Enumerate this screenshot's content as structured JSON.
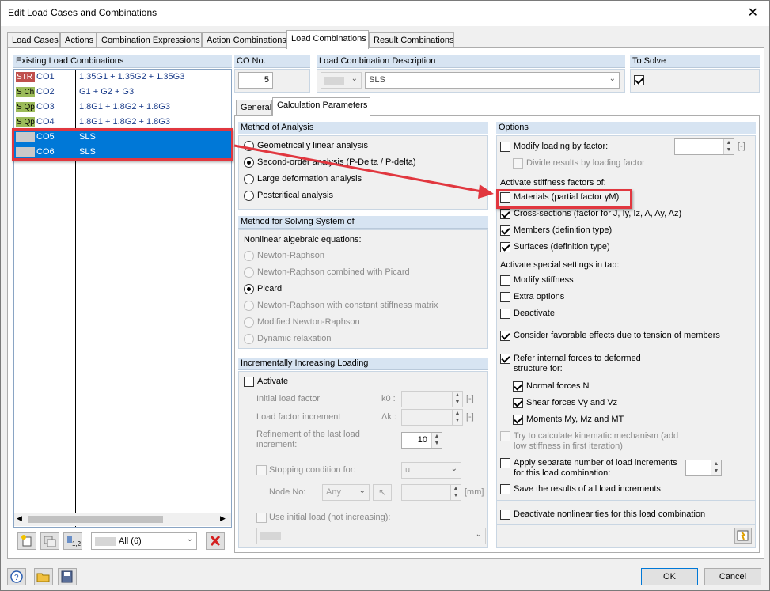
{
  "window": {
    "title": "Edit Load Cases and Combinations",
    "close": "✕"
  },
  "tabs": [
    "Load Cases",
    "Actions",
    "Combination Expressions",
    "Action Combinations",
    "Load Combinations",
    "Result Combinations"
  ],
  "existing": {
    "header": "Existing Load Combinations",
    "rows": [
      {
        "badge": "STR",
        "badge_color": "#c0504d",
        "badge_text_color": "#ffffff",
        "code": "CO1",
        "expr": "1.35G1 + 1.35G2 + 1.35G3"
      },
      {
        "badge": "S Ch",
        "badge_color": "#9bbb59",
        "badge_text_color": "#000000",
        "code": "CO2",
        "expr": "G1 + G2 + G3"
      },
      {
        "badge": "S Qp",
        "badge_color": "#9bbb59",
        "badge_text_color": "#000000",
        "code": "CO3",
        "expr": "1.8G1 + 1.8G2 + 1.8G3"
      },
      {
        "badge": "S Qp",
        "badge_color": "#9bbb59",
        "badge_text_color": "#000000",
        "code": "CO4",
        "expr": "1.8G1 + 1.8G2 + 1.8G3"
      },
      {
        "badge": "",
        "badge_color": "#c9c9c9",
        "badge_text_color": "#000000",
        "code": "CO5",
        "expr": "SLS"
      },
      {
        "badge": "",
        "badge_color": "#c9c9c9",
        "badge_text_color": "#000000",
        "code": "CO6",
        "expr": "SLS"
      }
    ],
    "filter_value": "All (6)"
  },
  "co_no": {
    "label": "CO No.",
    "value": "5"
  },
  "description": {
    "label": "Load Combination Description",
    "value": "SLS"
  },
  "to_solve": {
    "label": "To Solve"
  },
  "subtabs": [
    "General",
    "Calculation Parameters"
  ],
  "method_analysis": {
    "header": "Method of Analysis",
    "options": [
      "Geometrically linear analysis",
      "Second-order analysis (P-Delta / P-delta)",
      "Large deformation analysis",
      "Postcritical analysis"
    ]
  },
  "method_solving": {
    "header": "Method for Solving System of",
    "subtitle": "Nonlinear algebraic equations:",
    "options": [
      "Newton-Raphson",
      "Newton-Raphson combined with Picard",
      "Picard",
      "Newton-Raphson with constant stiffness matrix",
      "Modified Newton-Raphson",
      "Dynamic relaxation"
    ]
  },
  "incremental": {
    "header": "Incrementally Increasing Loading",
    "activate": "Activate",
    "initial_factor": "Initial load factor",
    "initial_symbol": "k0 :",
    "factor_increment": "Load factor increment",
    "increment_symbol": "Δk :",
    "unit_blank": "[-]",
    "refinement": "Refinement of the last load increment:",
    "refinement_value": "10",
    "stopping": "Stopping condition for:",
    "stopping_value": "u",
    "node_no": "Node No:",
    "node_value": "Any",
    "unit_mm": "[mm]",
    "use_initial": "Use initial load (not increasing):"
  },
  "options": {
    "header": "Options",
    "modify_loading": "Modify loading by factor:",
    "unit_blank": "[-]",
    "divide_results": "Divide results by loading factor",
    "stiffness_title": "Activate stiffness factors of:",
    "materials": "Materials (partial factor γM)",
    "cross_sections": "Cross-sections (factor for J, Iy, Iz, A, Ay, Az)",
    "members": "Members (definition type)",
    "surfaces": "Surfaces (definition type)",
    "special_title": "Activate special settings in tab:",
    "modify_stiffness": "Modify stiffness",
    "extra_options": "Extra options",
    "deactivate": "Deactivate",
    "favorable": "Consider favorable effects due to tension of members",
    "refer_internal": "Refer internal forces to deformed structure for:",
    "normal_forces": "Normal forces N",
    "shear_forces": "Shear forces Vy and Vz",
    "moments": "Moments My, Mz and MT",
    "kinematic": "Try to calculate kinematic mechanism (add low stiffness in first iteration)",
    "apply_separate": "Apply separate number of load increments for this load combination:",
    "save_results": "Save the results of all load increments",
    "deactivate_nonlin": "Deactivate nonlinearities for this load combination"
  },
  "buttons": {
    "ok": "OK",
    "cancel": "Cancel"
  },
  "colors": {
    "selection": "#0078d7",
    "header": "#d7e4f2",
    "highlight_red": "#e1373f"
  }
}
